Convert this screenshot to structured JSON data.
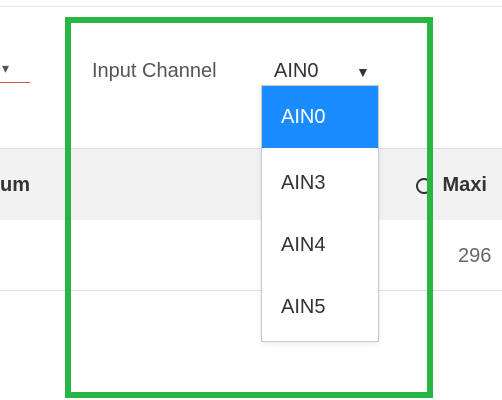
{
  "filter": {
    "input_channel_label": "Input Channel",
    "input_channel_value": "AIN0",
    "chevron_glyph": "▼",
    "left_dropdown_chevron_glyph": "▾"
  },
  "dropdown": {
    "options": [
      {
        "label": "AIN0",
        "selected": true
      },
      {
        "label": "AIN3",
        "selected": false
      },
      {
        "label": "AIN4",
        "selected": false
      },
      {
        "label": "AIN5",
        "selected": false
      }
    ]
  },
  "table": {
    "headers": {
      "min_partial": "um",
      "max_partial": "Maxi"
    },
    "row": {
      "max_partial": "296"
    }
  },
  "colors": {
    "highlight": "#27b543",
    "selected_option_bg": "#1a8cff",
    "left_underline": "#d9534f"
  },
  "icons": {
    "info": "info-circle-icon"
  }
}
